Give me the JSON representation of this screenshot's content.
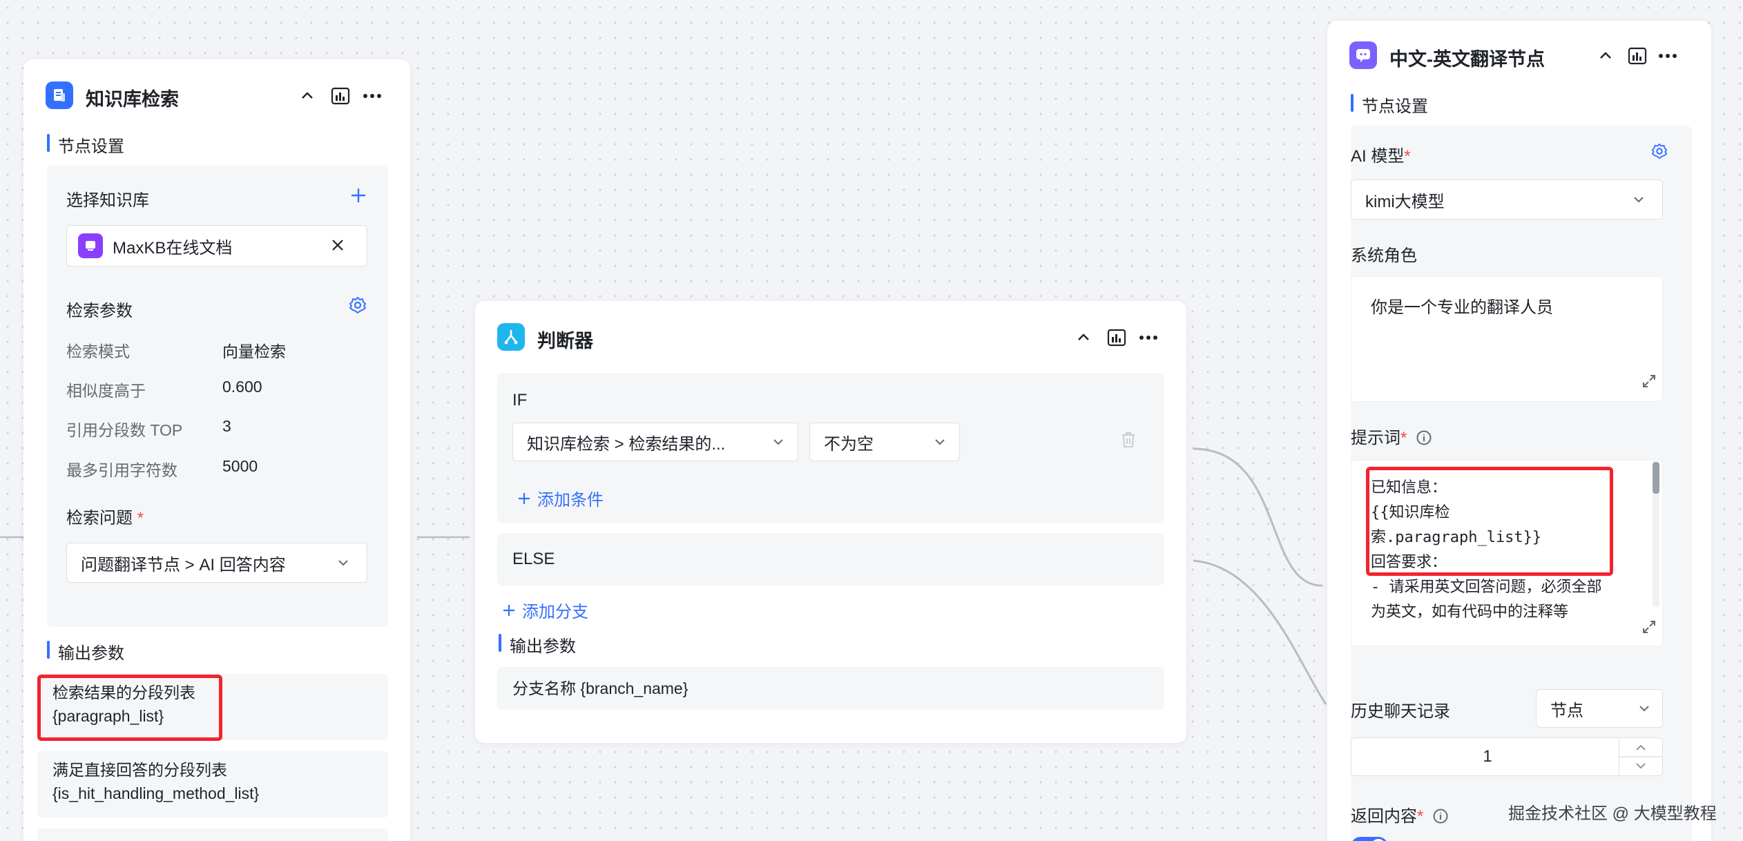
{
  "node_kb": {
    "title": "知识库检索",
    "settings_label": "节点设置",
    "select_kb_label": "选择知识库",
    "selected_kb": "MaxKB在线文档",
    "search_params_label": "检索参数",
    "params": [
      {
        "label": "检索模式",
        "value": "向量检索"
      },
      {
        "label": "相似度高于",
        "value": "0.600"
      },
      {
        "label": "引用分段数 TOP",
        "value": "3"
      },
      {
        "label": "最多引用字符数",
        "value": "5000"
      }
    ],
    "question_label": "检索问题",
    "required_mark": "*",
    "question_value": "问题翻译节点 > AI 回答内容",
    "output_label": "输出参数",
    "outputs": [
      {
        "name": "检索结果的分段列表",
        "var": "{paragraph_list}"
      },
      {
        "name": "满足直接回答的分段列表",
        "var": "{is_hit_handling_method_list}"
      }
    ]
  },
  "node_judge": {
    "title": "判断器",
    "if_label": "IF",
    "condition_field": "知识库检索 > 检索结果的...",
    "condition_op": "不为空",
    "add_condition": "添加条件",
    "else_label": "ELSE",
    "add_branch": "添加分支",
    "output_label": "输出参数",
    "output_value": "分支名称 {branch_name}"
  },
  "node_translate": {
    "title": "中文-英文翻译节点",
    "settings_label": "节点设置",
    "model_label": "AI 模型",
    "required_mark": "*",
    "model_value": "kimi大模型",
    "system_role_label": "系统角色",
    "system_role_value": "你是一个专业的翻译人员",
    "prompt_label": "提示词",
    "prompt_lines": [
      "已知信息：",
      "{{知识库检",
      "索.paragraph_list}}",
      "回答要求：",
      "- 请采用英文回答问题，必须全部",
      "为英文，如有代码中的注释等"
    ],
    "history_label": "历史聊天记录",
    "history_mode": "节点",
    "history_count": "1",
    "return_label": "返回内容"
  },
  "watermark": "掘金技术社区 @ 大模型教程",
  "colors": {
    "accent": "#3370ff",
    "highlight": "#f5222d",
    "kb_icon": "#3370ff",
    "judge_icon": "#1fb6f0",
    "translate_icon": "#7b61ff",
    "kb_doc_icon": "#8a3ffc"
  }
}
